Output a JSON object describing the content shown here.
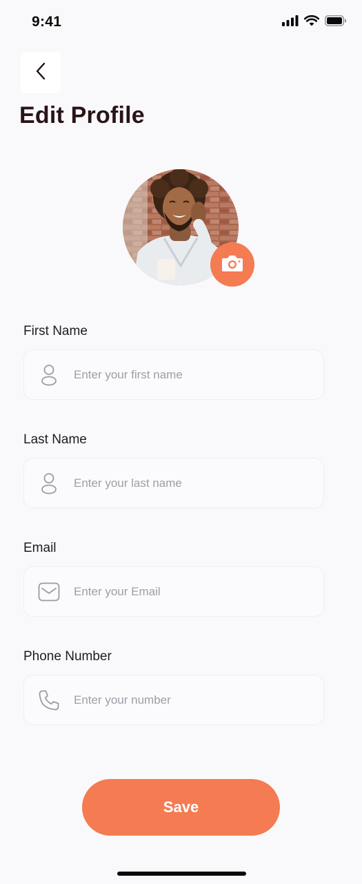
{
  "status_bar": {
    "time": "9:41"
  },
  "header": {
    "title": "Edit Profile"
  },
  "profile": {
    "avatar_icon": "profile-photo",
    "camera_icon": "camera-icon"
  },
  "form": {
    "fields": [
      {
        "label": "First Name",
        "placeholder": "Enter your first name",
        "icon": "user-icon"
      },
      {
        "label": "Last Name",
        "placeholder": "Enter your last name",
        "icon": "user-icon"
      },
      {
        "label": "Email",
        "placeholder": "Enter your Email",
        "icon": "mail-icon"
      },
      {
        "label": "Phone Number",
        "placeholder": "Enter your number",
        "icon": "phone-icon"
      }
    ]
  },
  "actions": {
    "save_label": "Save"
  },
  "colors": {
    "accent": "#f47b52",
    "background": "#f9f9fb",
    "title": "#2a1418"
  }
}
